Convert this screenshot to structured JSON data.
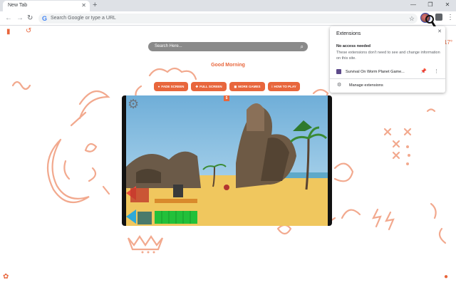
{
  "tab": {
    "title": "New Tab",
    "close": "✕",
    "new_tab": "+"
  },
  "window_controls": {
    "minimize": "—",
    "restore": "❐",
    "close": "✕"
  },
  "toolbar": {
    "back": "←",
    "forward": "→",
    "reload": "↻",
    "omnibox_placeholder": "Search Google or type a URL",
    "google_g": "G",
    "star": "☆",
    "menu": "⋮"
  },
  "page": {
    "search_placeholder": "Search Here...",
    "greeting": "Good Morning",
    "buttons": [
      "FADE SCREEN",
      "FULL SCREEN",
      "MORE GAMES",
      "HOW TO PLAY"
    ],
    "game_badge": "5"
  },
  "extensions_popup": {
    "title": "Extensions",
    "close": "✕",
    "subtitle": "No access needed",
    "description": "These extensions don't need to see and change information on this site.",
    "item_name": "Survival On Worm Planet Game...",
    "pin": "📌",
    "more": "⋮",
    "manage": "Manage extensions",
    "manage_icon": "⚙"
  },
  "weather_text": "17°",
  "colors": {
    "accent": "#e8663c",
    "sand": "#f0c75e",
    "sky": "#8ec3e6"
  }
}
